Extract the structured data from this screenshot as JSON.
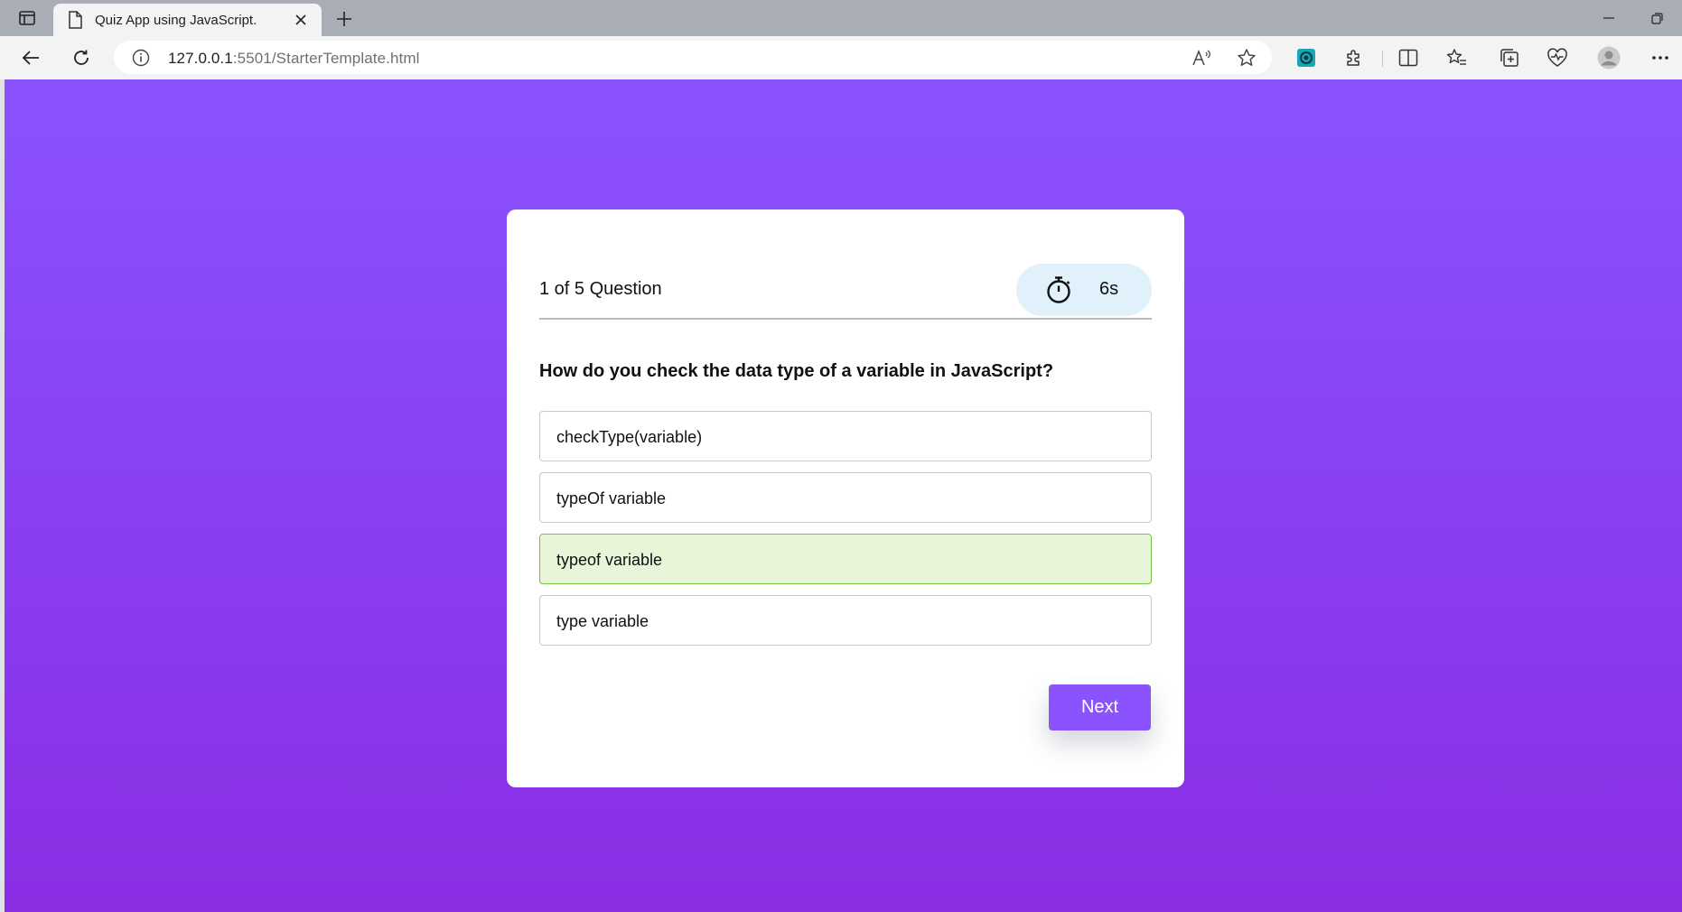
{
  "browser": {
    "tab_title": "Quiz App using JavaScript.",
    "url_host": "127.0.0.1",
    "url_rest": ":5501/StarterTemplate.html",
    "accent": "#8a53fd"
  },
  "quiz": {
    "progress_text": "1 of 5 Question",
    "timer_value": "6s",
    "question": "How do you check the data type of a variable in JavaScript?",
    "options": [
      {
        "label": "checkType(variable)",
        "state": "default"
      },
      {
        "label": "typeOf variable",
        "state": "default"
      },
      {
        "label": "typeof variable",
        "state": "correct"
      },
      {
        "label": "type variable",
        "state": "default"
      }
    ],
    "next_label": "Next",
    "colors": {
      "background_top": "#8a53fd",
      "background_bottom": "#8a2ee4",
      "correct_fill": "#e8f5d9",
      "correct_border": "#76c247",
      "timer_fill": "#e1f1fc"
    }
  }
}
